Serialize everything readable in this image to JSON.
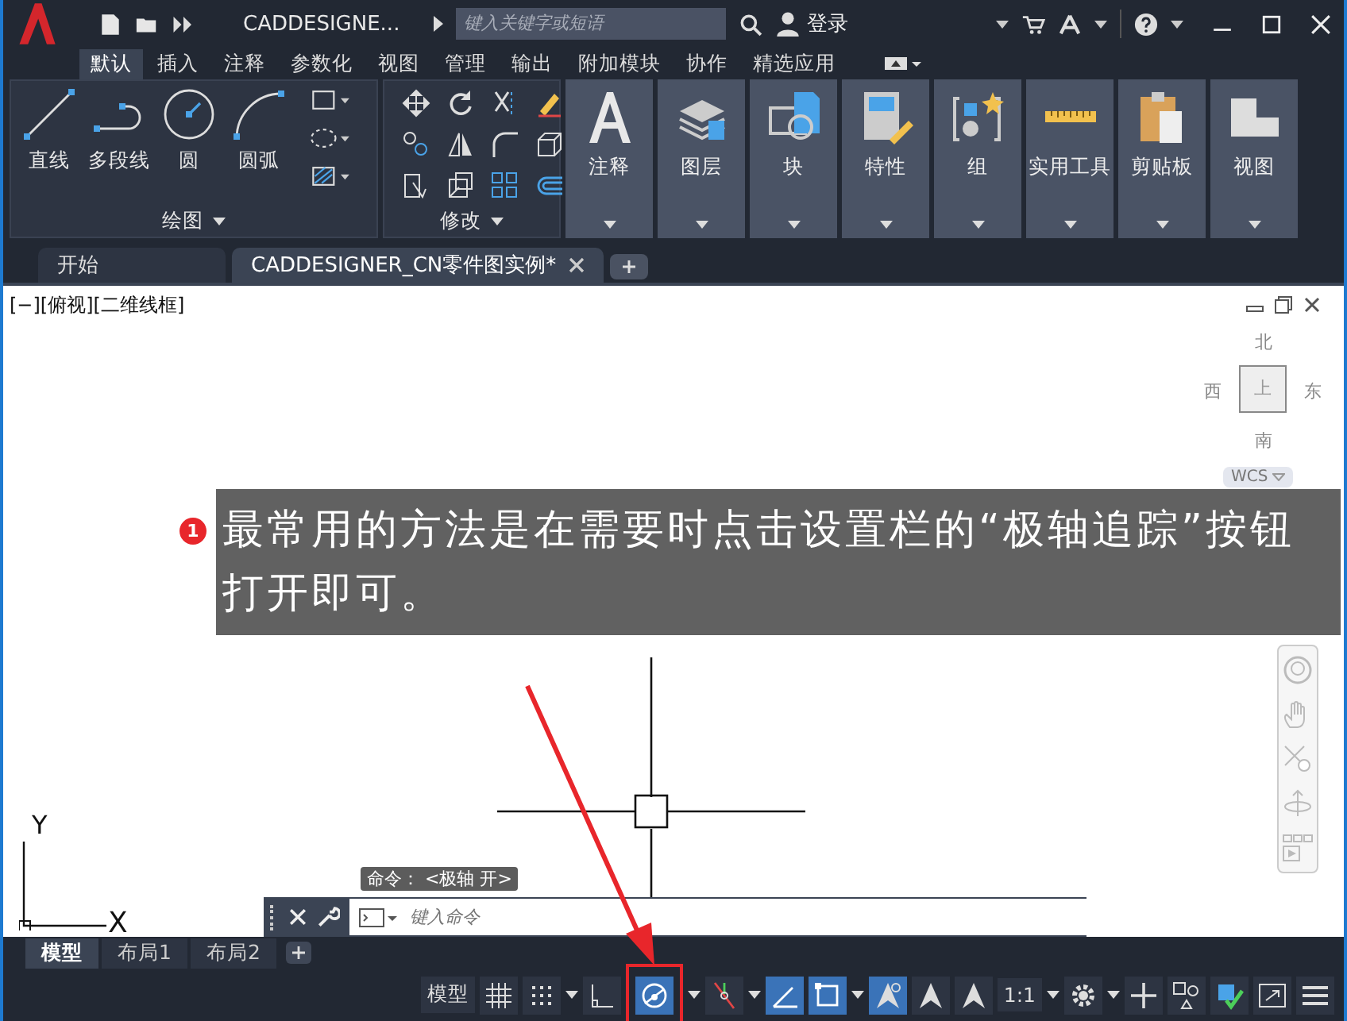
{
  "title_bar": {
    "document_title": "CADDESIGNE...",
    "search_placeholder": "键入关键字或短语",
    "user": "登录"
  },
  "ribbon_tabs": [
    {
      "label": "默认",
      "selected": true
    },
    {
      "label": "插入",
      "selected": false
    },
    {
      "label": "注释",
      "selected": false
    },
    {
      "label": "参数化",
      "selected": false
    },
    {
      "label": "视图",
      "selected": false
    },
    {
      "label": "管理",
      "selected": false
    },
    {
      "label": "输出",
      "selected": false
    },
    {
      "label": "附加模块",
      "selected": false
    },
    {
      "label": "协作",
      "selected": false
    },
    {
      "label": "精选应用",
      "selected": false
    }
  ],
  "draw_panel": {
    "title": "绘图",
    "tools": [
      {
        "kind": "line",
        "label": "直线"
      },
      {
        "kind": "polyline",
        "label": "多段线"
      },
      {
        "kind": "circle",
        "label": "圆"
      },
      {
        "kind": "arc",
        "label": "圆弧"
      }
    ]
  },
  "modify_panel": {
    "title": "修改"
  },
  "big_panels": [
    {
      "kind": "annotate",
      "label": "注释"
    },
    {
      "kind": "layers",
      "label": "图层"
    },
    {
      "kind": "block",
      "label": "块"
    },
    {
      "kind": "properties",
      "label": "特性"
    },
    {
      "kind": "group",
      "label": "组"
    },
    {
      "kind": "utilities",
      "label": "实用工具"
    },
    {
      "kind": "clipboard",
      "label": "剪贴板"
    },
    {
      "kind": "view",
      "label": "视图"
    }
  ],
  "doc_tabs": [
    {
      "label": "开始",
      "selected": false
    },
    {
      "label": "CADDESIGNER_CN零件图实例*",
      "selected": true
    }
  ],
  "viewport": {
    "label": "[−][俯视][二维线框]",
    "compass": {
      "north": "北",
      "south": "南",
      "east": "东",
      "west": "西",
      "face": "上"
    },
    "ucs": "WCS",
    "axis_y": "Y",
    "axis_x": "X"
  },
  "annotation": {
    "number": "1",
    "text": "最常用的方法是在需要时点击设置栏的“极轴追踪”按钮打开即可。"
  },
  "command": {
    "tooltip": "命令： <极轴 开>",
    "placeholder": "键入命令"
  },
  "layout_tabs": [
    {
      "label": "模型",
      "selected": true
    },
    {
      "label": "布局1",
      "selected": false
    },
    {
      "label": "布局2",
      "selected": false
    }
  ],
  "status_items": [
    {
      "kind": "text",
      "label": "模型"
    },
    {
      "kind": "grid",
      "on": false
    },
    {
      "kind": "snap",
      "on": false
    },
    {
      "kind": "caret"
    },
    {
      "kind": "ortho",
      "on": false
    },
    {
      "kind": "polar",
      "on": true,
      "highlighted": true
    },
    {
      "kind": "caret"
    },
    {
      "kind": "osnap",
      "on": false
    },
    {
      "kind": "caret"
    },
    {
      "kind": "iso",
      "on": true
    },
    {
      "kind": "box",
      "on": true
    },
    {
      "kind": "caret"
    },
    {
      "kind": "anno",
      "on": true
    },
    {
      "kind": "anno2"
    },
    {
      "kind": "anno3"
    },
    {
      "kind": "text",
      "label": "1:1"
    },
    {
      "kind": "caret"
    },
    {
      "kind": "gear"
    },
    {
      "kind": "caret"
    },
    {
      "kind": "plus"
    },
    {
      "kind": "iso2"
    },
    {
      "kind": "check"
    },
    {
      "kind": "fullscreen"
    },
    {
      "kind": "menu"
    }
  ]
}
